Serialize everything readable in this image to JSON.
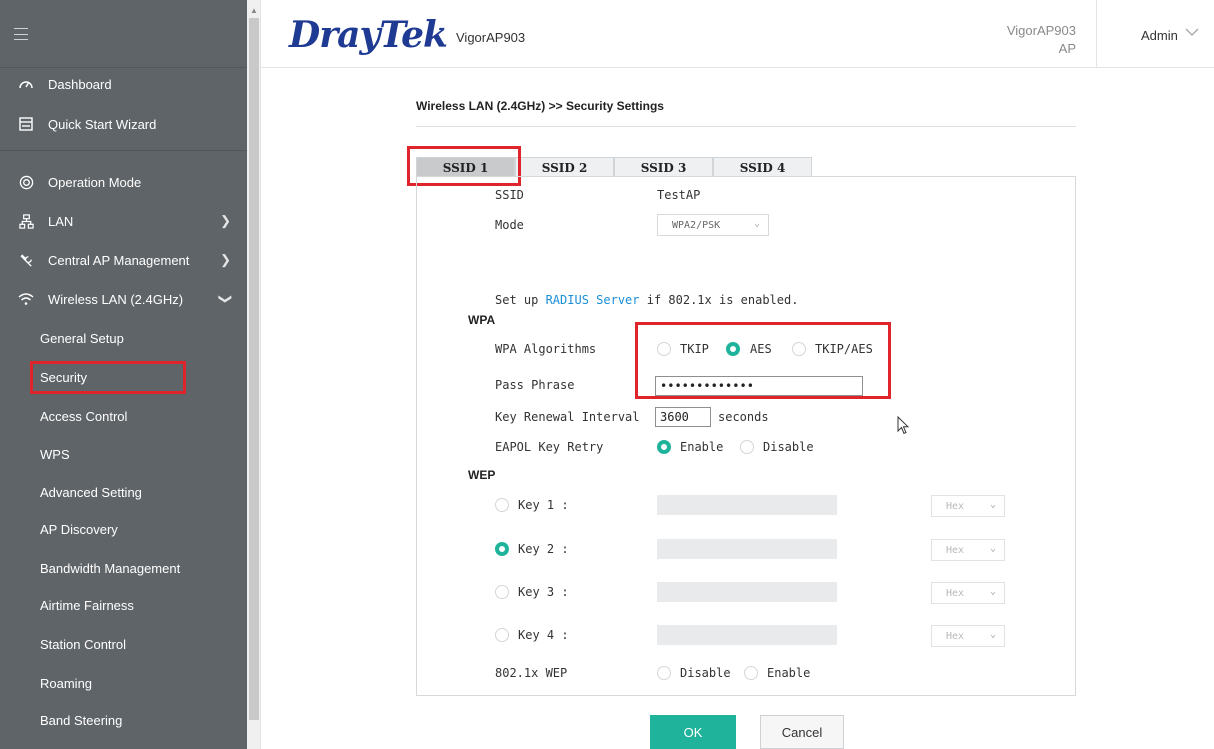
{
  "sidebar": {
    "items": [
      {
        "label": "Dashboard",
        "icon": "gauge-icon"
      },
      {
        "label": "Quick Start Wizard",
        "icon": "wizard-icon"
      },
      {
        "label": "Operation Mode",
        "icon": "target-icon"
      },
      {
        "label": "LAN",
        "icon": "network-icon"
      },
      {
        "label": "Central AP Management",
        "icon": "wrench-icon"
      },
      {
        "label": "Wireless LAN (2.4GHz)",
        "icon": "wifi-icon"
      }
    ],
    "subitems": [
      "General Setup",
      "Security",
      "Access Control",
      "WPS",
      "Advanced Setting",
      "AP Discovery",
      "Bandwidth Management",
      "Airtime Fairness",
      "Station Control",
      "Roaming",
      "Band Steering"
    ]
  },
  "header": {
    "brand": "DrayTek",
    "model": "VigorAP903",
    "right_model_line1": "VigorAP903",
    "right_model_line2": "AP",
    "user": "Admin"
  },
  "main": {
    "breadcrumb": "Wireless LAN (2.4GHz) >> Security Settings",
    "tabs": [
      "SSID 1",
      "SSID 2",
      "SSID 3",
      "SSID 4"
    ],
    "ssid_label": "SSID",
    "ssid_value": "TestAP",
    "mode_label": "Mode",
    "mode_value": "WPA2/PSK",
    "radius_prefix": "Set up ",
    "radius_link": "RADIUS Server",
    "radius_suffix": " if 802.1x is enabled.",
    "wpa_heading": "WPA",
    "wpa_algorithms_label": "WPA Algorithms",
    "alg_tkip": "TKIP",
    "alg_aes": "AES",
    "alg_tkip_aes": "TKIP/AES",
    "pass_phrase_label": "Pass Phrase",
    "pass_phrase_value": "•••••••••••••",
    "key_renewal_label": "Key Renewal Interval",
    "key_renewal_value": "3600",
    "key_renewal_unit": "seconds",
    "eapol_label": "EAPOL Key Retry",
    "eapol_enable": "Enable",
    "eapol_disable": "Disable",
    "wep_heading": "WEP",
    "wep_keys": [
      "Key  1 :",
      "Key  2 :",
      "Key  3 :",
      "Key  4 :"
    ],
    "wep_key_format": "Hex",
    "wep_8021x_label": "802.1x WEP",
    "wep_8021x_disable": "Disable",
    "wep_8021x_enable": "Enable"
  },
  "buttons": {
    "ok": "OK",
    "cancel": "Cancel"
  },
  "colors": {
    "accent": "#20b39b",
    "highlight": "#e0242b",
    "sidebar_bg": "#5f6468",
    "brand": "#1f3a93",
    "link": "#1a8fd6"
  }
}
